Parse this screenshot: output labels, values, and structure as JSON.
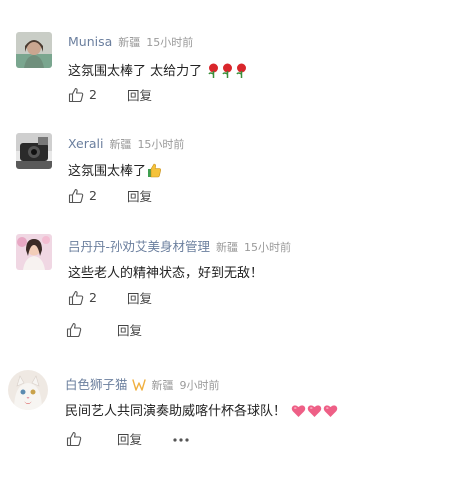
{
  "comments": [
    {
      "name": "Munisa",
      "location": "新疆",
      "time": "15小时前",
      "text": "这氛围太棒了 太给力了",
      "emojis": [
        "rose-emoji",
        "rose-emoji",
        "rose-emoji"
      ],
      "likes": "2",
      "reply": "回复"
    },
    {
      "name": "Xerali",
      "location": "新疆",
      "time": "15小时前",
      "text": "这氛围太棒了",
      "emojis": [
        "thumbs-up-emoji"
      ],
      "likes": "2",
      "reply": "回复"
    },
    {
      "name": "吕丹丹-孙劝艾美身材管理",
      "location": "新疆",
      "time": "15小时前",
      "text": "这些老人的精神状态，好到无敌！",
      "likes": "2",
      "reply": "回复"
    },
    {
      "likes": "",
      "reply": "回复"
    },
    {
      "name": "白色狮子猫",
      "location": "新疆",
      "time": "9小时前",
      "text": "民间艺人共同演奏助威喀什杯各球队！",
      "emojis": [
        "heart-emoji",
        "heart-emoji",
        "heart-emoji"
      ],
      "likes": "",
      "reply": "回复",
      "more": "more-icon"
    }
  ],
  "colors": {
    "name": "#6b7f9e",
    "meta": "#9a9a9a",
    "text": "#222222",
    "heart": "#ee5f86",
    "vip": "#f0b040"
  }
}
